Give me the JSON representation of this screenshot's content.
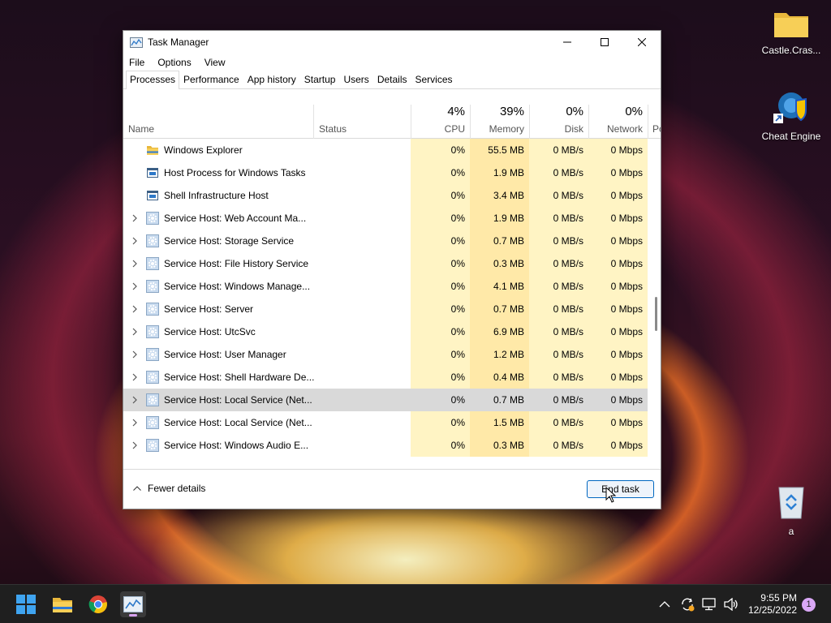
{
  "desktop": {
    "icons": [
      {
        "label": "Castle.Cras...",
        "icon": "folder-icon"
      },
      {
        "label": "Cheat Engine",
        "icon": "cheat-engine-icon"
      },
      {
        "label": "a",
        "icon": "recycle-bin-icon"
      }
    ]
  },
  "window": {
    "title": "Task Manager",
    "menu": [
      "File",
      "Options",
      "View"
    ],
    "tabs": [
      "Processes",
      "Performance",
      "App history",
      "Startup",
      "Users",
      "Details",
      "Services"
    ],
    "active_tab": "Processes",
    "columns": {
      "name": "Name",
      "status": "Status",
      "cpu": {
        "pct": "4%",
        "label": "CPU"
      },
      "memory": {
        "pct": "39%",
        "label": "Memory"
      },
      "disk": {
        "pct": "0%",
        "label": "Disk"
      },
      "network": {
        "pct": "0%",
        "label": "Network"
      },
      "power": "Po"
    },
    "processes": [
      {
        "name": "Windows Explorer",
        "icon": "explorer-icon",
        "expandable": false,
        "cpu": "0%",
        "memory": "55.5 MB",
        "disk": "0 MB/s",
        "network": "0 Mbps"
      },
      {
        "name": "Host Process for Windows Tasks",
        "icon": "window-app-icon",
        "expandable": false,
        "cpu": "0%",
        "memory": "1.9 MB",
        "disk": "0 MB/s",
        "network": "0 Mbps"
      },
      {
        "name": "Shell Infrastructure Host",
        "icon": "window-app-icon",
        "expandable": false,
        "cpu": "0%",
        "memory": "3.4 MB",
        "disk": "0 MB/s",
        "network": "0 Mbps"
      },
      {
        "name": "Service Host: Web Account Ma...",
        "icon": "gear-icon",
        "expandable": true,
        "cpu": "0%",
        "memory": "1.9 MB",
        "disk": "0 MB/s",
        "network": "0 Mbps"
      },
      {
        "name": "Service Host: Storage Service",
        "icon": "gear-icon",
        "expandable": true,
        "cpu": "0%",
        "memory": "0.7 MB",
        "disk": "0 MB/s",
        "network": "0 Mbps"
      },
      {
        "name": "Service Host: File History Service",
        "icon": "gear-icon",
        "expandable": true,
        "cpu": "0%",
        "memory": "0.3 MB",
        "disk": "0 MB/s",
        "network": "0 Mbps"
      },
      {
        "name": "Service Host: Windows Manage...",
        "icon": "gear-icon",
        "expandable": true,
        "cpu": "0%",
        "memory": "4.1 MB",
        "disk": "0 MB/s",
        "network": "0 Mbps"
      },
      {
        "name": "Service Host: Server",
        "icon": "gear-icon",
        "expandable": true,
        "cpu": "0%",
        "memory": "0.7 MB",
        "disk": "0 MB/s",
        "network": "0 Mbps"
      },
      {
        "name": "Service Host: UtcSvc",
        "icon": "gear-icon",
        "expandable": true,
        "cpu": "0%",
        "memory": "6.9 MB",
        "disk": "0 MB/s",
        "network": "0 Mbps"
      },
      {
        "name": "Service Host: User Manager",
        "icon": "gear-icon",
        "expandable": true,
        "cpu": "0%",
        "memory": "1.2 MB",
        "disk": "0 MB/s",
        "network": "0 Mbps"
      },
      {
        "name": "Service Host: Shell Hardware De...",
        "icon": "gear-icon",
        "expandable": true,
        "cpu": "0%",
        "memory": "0.4 MB",
        "disk": "0 MB/s",
        "network": "0 Mbps"
      },
      {
        "name": "Service Host: Local Service (Net...",
        "icon": "gear-icon",
        "expandable": true,
        "selected": true,
        "cpu": "0%",
        "memory": "0.7 MB",
        "disk": "0 MB/s",
        "network": "0 Mbps"
      },
      {
        "name": "Service Host: Local Service (Net...",
        "icon": "gear-icon",
        "expandable": true,
        "cpu": "0%",
        "memory": "1.5 MB",
        "disk": "0 MB/s",
        "network": "0 Mbps"
      },
      {
        "name": "Service Host: Windows Audio E...",
        "icon": "gear-icon",
        "expandable": true,
        "cpu": "0%",
        "memory": "0.3 MB",
        "disk": "0 MB/s",
        "network": "0 Mbps"
      }
    ],
    "footer": {
      "fewer_details": "Fewer details",
      "end_task": "End task"
    }
  },
  "taskbar": {
    "apps": [
      "start-icon",
      "file-explorer-icon",
      "chrome-icon",
      "task-manager-icon"
    ],
    "clock": {
      "time": "9:55 PM",
      "date": "12/25/2022"
    },
    "notifications": "1"
  },
  "colors": {
    "heat_light": "#fff4c4",
    "heat_medium": "#ffe9a8",
    "selection": "#d9d9d9",
    "accent": "#0067c0"
  }
}
